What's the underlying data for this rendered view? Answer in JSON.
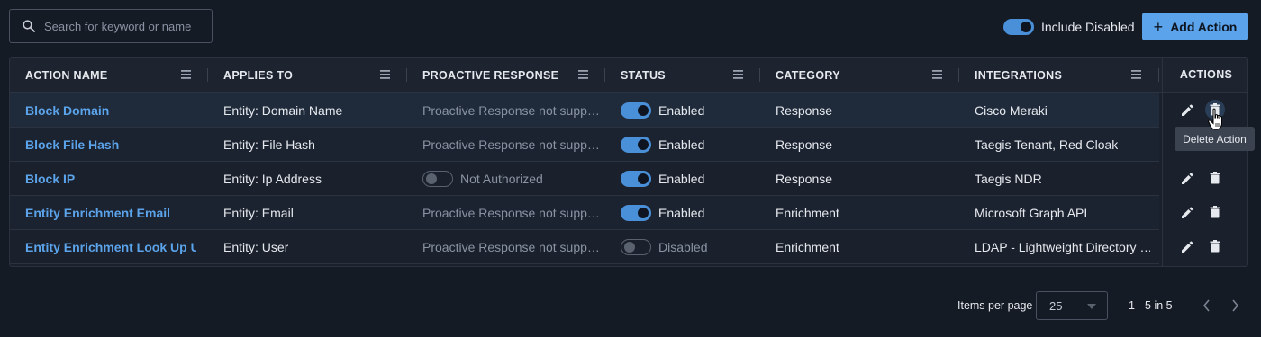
{
  "search": {
    "placeholder": "Search for keyword or name"
  },
  "toolbar": {
    "include_disabled_label": "Include Disabled",
    "include_disabled_on": true,
    "add_action_label": "Add Action"
  },
  "table": {
    "columns": [
      "ACTION NAME",
      "APPLIES TO",
      "PROACTIVE RESPONSE",
      "STATUS",
      "CATEGORY",
      "INTEGRATIONS",
      "ACTIONS"
    ],
    "rows": [
      {
        "name": "Block Domain",
        "applies_to": "Entity: Domain Name",
        "proactive": "Proactive Response not supp…",
        "proactive_toggle": false,
        "status": "Enabled",
        "status_on": true,
        "category": "Response",
        "integrations": "Cisco Meraki"
      },
      {
        "name": "Block File Hash",
        "applies_to": "Entity: File Hash",
        "proactive": "Proactive Response not supp…",
        "proactive_toggle": false,
        "status": "Enabled",
        "status_on": true,
        "category": "Response",
        "integrations": "Taegis Tenant, Red Cloak"
      },
      {
        "name": "Block IP",
        "applies_to": "Entity: Ip Address",
        "proactive": "Not Authorized",
        "proactive_toggle": true,
        "status": "Enabled",
        "status_on": true,
        "category": "Response",
        "integrations": "Taegis NDR"
      },
      {
        "name": "Entity Enrichment Email",
        "applies_to": "Entity: Email",
        "proactive": "Proactive Response not supp…",
        "proactive_toggle": false,
        "status": "Enabled",
        "status_on": true,
        "category": "Enrichment",
        "integrations": "Microsoft Graph API"
      },
      {
        "name": "Entity Enrichment Look Up U…",
        "applies_to": "Entity: User",
        "proactive": "Proactive Response not supp…",
        "proactive_toggle": false,
        "status": "Disabled",
        "status_on": false,
        "category": "Enrichment",
        "integrations": "LDAP - Lightweight Directory …"
      }
    ]
  },
  "tooltip": {
    "text": "Delete Action"
  },
  "pagination": {
    "items_per_page_label": "Items per page",
    "items_per_page_value": "25",
    "range": "1 - 5 in 5"
  },
  "colors": {
    "accent": "#5ba3ea",
    "background": "#151b25",
    "toggle_on": "#4a90d9"
  }
}
